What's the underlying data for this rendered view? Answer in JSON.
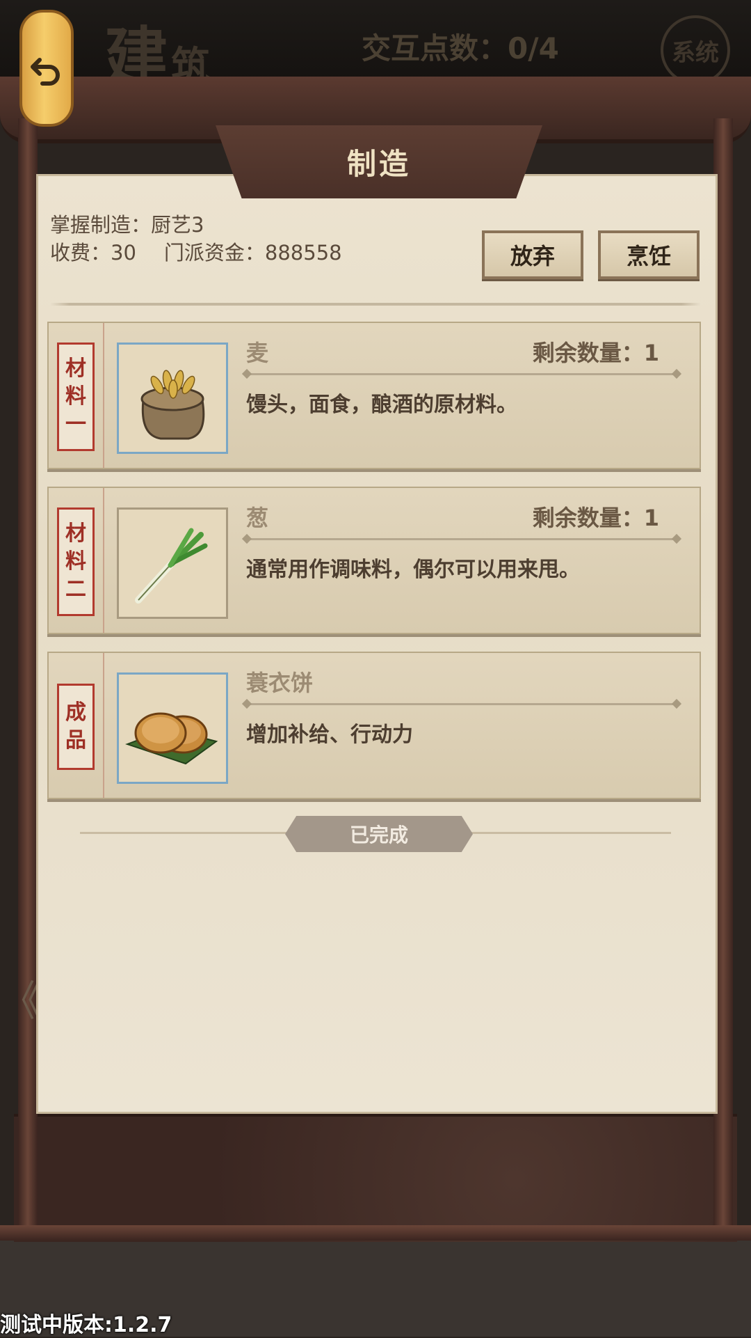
{
  "hud": {
    "building_title": "建",
    "building_title_small": "筑",
    "interaction_points": "交互点数：0/4",
    "system_label": "系统"
  },
  "dialog": {
    "title": "制造",
    "skill_line": "掌握制造：厨艺3",
    "fee_line": "收费：30",
    "funds_line": "门派资金：888558",
    "abandon_label": "放弃",
    "cook_label": "烹饪"
  },
  "cards": [
    {
      "tag": [
        "材",
        "料",
        "一"
      ],
      "name": "麦",
      "remaining": "剩余数量：1",
      "description": "馒头，面食，酿酒的原材料。",
      "icon": "wheat-sack-icon"
    },
    {
      "tag": [
        "材",
        "料",
        "二"
      ],
      "name": "葱",
      "remaining": "剩余数量：1",
      "description": "通常用作调味料，偶尔可以用来甩。",
      "icon": "green-onion-icon"
    },
    {
      "tag": [
        "成",
        "品"
      ],
      "name": "蓑衣饼",
      "remaining": "",
      "description": "增加补给、行动力",
      "icon": "pancake-icon"
    }
  ],
  "status": {
    "completed_label": "已完成"
  },
  "footer": {
    "version": "测试中版本:1.2.7"
  },
  "colors": {
    "seal_red": "#b23a2e",
    "frame_brown": "#4a3028",
    "parchment": "#ece3d0"
  }
}
